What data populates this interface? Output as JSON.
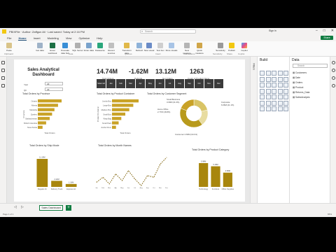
{
  "titlebar": {
    "filename": "PBIXFile · Author: Zaffgun Ali  ·  Last saved: Today at 2:16 PM",
    "search_placeholder": "Search",
    "signin": "Sign in"
  },
  "menu": {
    "tabs": [
      "File",
      "Home",
      "Insert",
      "Modeling",
      "View",
      "Optimize",
      "Help"
    ],
    "active": "Home",
    "share": "Share"
  },
  "ribbon": {
    "buttons": [
      "Paste",
      "Get data",
      "Excel workbook",
      "OneLake data hub",
      "SQL Server",
      "Enter data",
      "Dataverse",
      "Recent sources",
      "Transform data",
      "Refresh",
      "New visual",
      "Text box",
      "More visuals",
      "New measure",
      "Quick measure",
      "Sensitivity",
      "Publish",
      "Copilot"
    ],
    "groups": [
      "Clipboard",
      "Data",
      "Queries",
      "Insert",
      "Calculations",
      "Sensitivity",
      "Share",
      "Copilot"
    ]
  },
  "report": {
    "title": "Sales Analytical Dashboard",
    "slicers": [
      {
        "label": "Year",
        "value": "All"
      },
      {
        "label": "Qtr",
        "value": "All"
      }
    ],
    "kpis": [
      {
        "value": "14.74M",
        "label": "Total Orders"
      },
      {
        "value": "-1.62M",
        "label": "Refunds"
      },
      {
        "value": "13.12M",
        "label": "Net Orders"
      },
      {
        "value": "1263",
        "label": "Count of Product Name"
      }
    ],
    "months": [
      "Select all",
      "Jan",
      "Feb",
      "Mar",
      "Apr",
      "May",
      "Jun",
      "Jul",
      "Aug",
      "Sep",
      "Oct",
      "Nov",
      "Dec"
    ]
  },
  "chart_data": [
    {
      "type": "bar",
      "title": "Total Orders by Province",
      "xlabel": "Total Orders",
      "ylabel": "Province",
      "categories": [
        "Ontario",
        "Alberta",
        "Manitoba",
        "Quebec",
        "Saskatchewan",
        "British Columbia",
        "Nova Scotia"
      ],
      "values": [
        1.0,
        0.85,
        0.7,
        0.6,
        0.5,
        0.35,
        0.2
      ]
    },
    {
      "type": "bar",
      "title": "Total Orders by Product Container",
      "ylabel": "Product Container",
      "xlabel": "Total Orders",
      "categories": [
        "Jumbo Box",
        "Large Box",
        "Medium Box",
        "Small Box",
        "Wrap Bag",
        "Small Pack",
        "Jumbo Drum"
      ],
      "values": [
        1.0,
        0.8,
        0.65,
        0.5,
        0.35,
        0.25,
        0.15
      ]
    },
    {
      "type": "pie",
      "title": "Total Orders by Customer Segment",
      "categories": [
        "Small Business",
        "Home Office",
        "Corporate",
        "Consumer"
      ],
      "values": [
        3.09,
        2.77,
        6.06,
        2.82
      ],
      "labels": [
        "Small Business\n3.09M (21.0%)",
        "Home Office\n2.77M (18.8%)",
        "Corporate\n6.06M (41.1%)",
        "Consumer 2.82M (19.1%)"
      ]
    },
    {
      "type": "bar",
      "title": "Total Orders by Ship Mode",
      "categories": [
        "Regular Air",
        "Delivery Truck",
        "Express Air"
      ],
      "values": [
        11.16,
        2.42,
        1.16
      ],
      "value_labels": [
        "11.16M",
        "2.42M",
        "1.16M"
      ]
    },
    {
      "type": "line",
      "title": "Total Orders by Month Names",
      "categories": [
        "Jan",
        "Feb",
        "Mar",
        "Apr",
        "May",
        "Jun",
        "Jul",
        "Aug",
        "Sep",
        "Oct",
        "Nov",
        "Dec"
      ],
      "values": [
        1.1,
        1.4,
        1.0,
        1.6,
        1.2,
        1.8,
        1.3,
        0.9,
        1.5,
        1.4,
        2.2,
        2.6
      ]
    },
    {
      "type": "bar",
      "title": "Total Orders by Product Category",
      "categories": [
        "Technology",
        "Furniture",
        "Office Supplies"
      ],
      "values": [
        5.98,
        5.18,
        3.58
      ],
      "value_labels": [
        "5.98M",
        "5.18M",
        "3.58M"
      ]
    }
  ],
  "pages": {
    "tab": "Sales Dashboard",
    "add": "+"
  },
  "status": {
    "left": "Page 1 of 1",
    "zoom": "65%"
  },
  "build": {
    "title": "Build"
  },
  "filters": {
    "title": "Filters"
  },
  "data_pane": {
    "title": "Data",
    "search_placeholder": "Search",
    "tables": [
      "Customers",
      "Date",
      "Orders",
      "Product",
      "Returns_Data",
      "SalesAnalysis"
    ]
  },
  "colors": {
    "accent": "#c9a227",
    "dark_gold": "#a8860d",
    "green": "#107c41"
  }
}
